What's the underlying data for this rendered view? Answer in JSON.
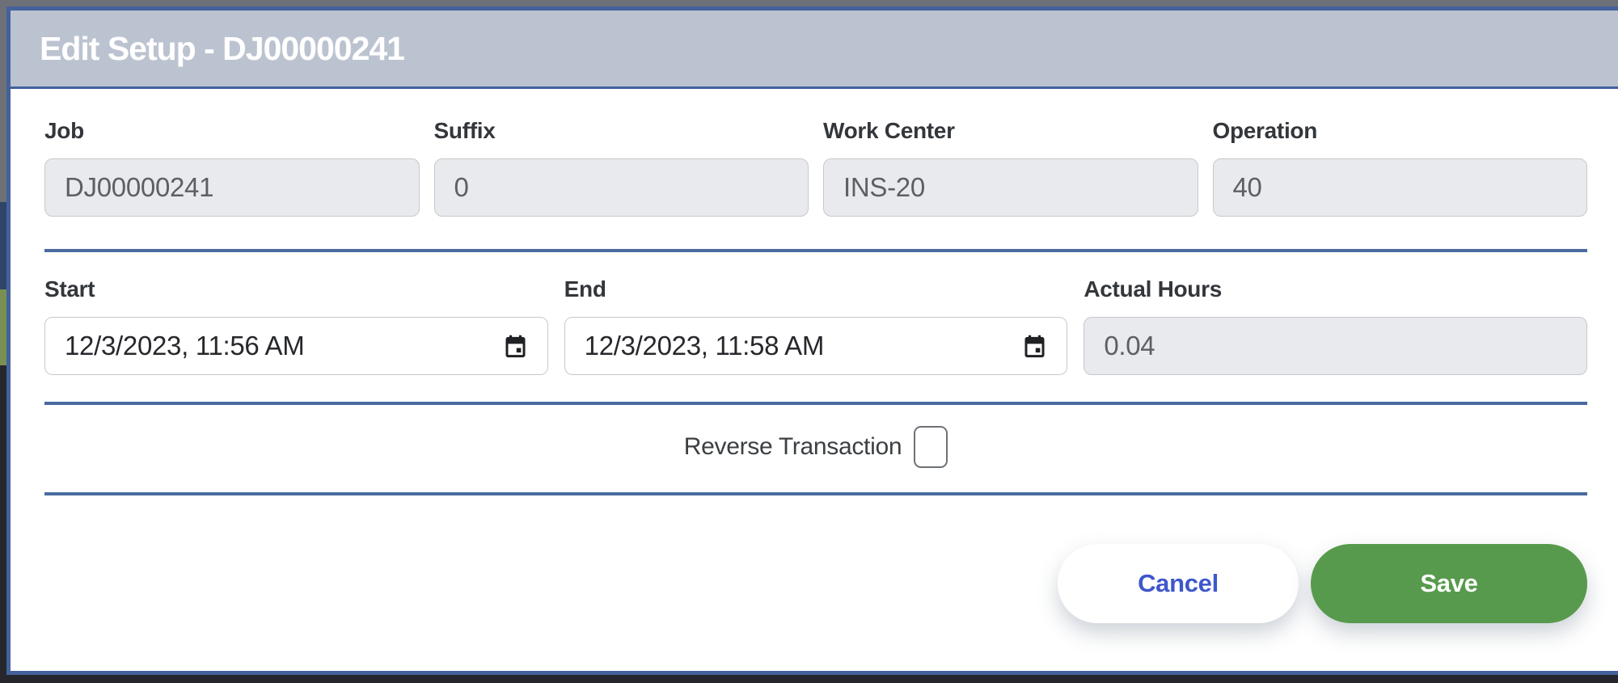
{
  "window": {
    "title": "Edit Setup - DJ00000241"
  },
  "form": {
    "row1": [
      {
        "label": "Job",
        "value": "DJ00000241",
        "disabled": true
      },
      {
        "label": "Suffix",
        "value": "0",
        "disabled": true
      },
      {
        "label": "Work Center",
        "value": "INS-20",
        "disabled": true
      },
      {
        "label": "Operation",
        "value": "40",
        "disabled": true
      }
    ],
    "row2": {
      "start": {
        "label": "Start",
        "value": "12/3/2023, 11:56 AM",
        "type": "datetime"
      },
      "end": {
        "label": "End",
        "value": "12/3/2023, 11:58 AM",
        "type": "datetime"
      },
      "actual_hours": {
        "label": "Actual Hours",
        "value": "0.04",
        "disabled": true
      }
    },
    "reverse_transaction": {
      "label": "Reverse Transaction",
      "checked": false
    }
  },
  "actions": {
    "cancel_label": "Cancel",
    "save_label": "Save"
  },
  "icons": {
    "calendar": "calendar-icon"
  },
  "colors": {
    "header_bg": "#bcc3d0",
    "modal_border": "#44619b",
    "divider": "#4a6b9f",
    "save_green": "#589a4d",
    "cancel_blue": "#3f57cb",
    "disabled_bg": "#e9eaed",
    "input_border": "#c6c8cb",
    "backdrop_gray": "#6e7077",
    "backdrop_navy": "#2e4468",
    "backdrop_olive": "#7a8f54",
    "backdrop_charcoal": "#25272c"
  }
}
